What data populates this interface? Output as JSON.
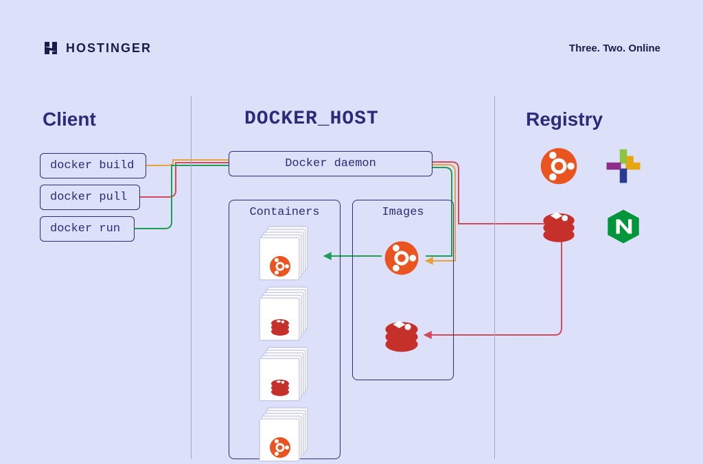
{
  "brand": {
    "name": "HOSTINGER",
    "tagline": "Three. Two. Online"
  },
  "columns": {
    "client": "Client",
    "host": "DOCKER_HOST",
    "registry": "Registry"
  },
  "client": {
    "cmd_build": "docker build",
    "cmd_pull": "docker pull",
    "cmd_run": "docker run"
  },
  "host": {
    "daemon": "Docker daemon",
    "containers_label": "Containers",
    "images_label": "Images"
  },
  "registry_items": [
    "ubuntu",
    "centos",
    "redis",
    "nginx"
  ],
  "containers": [
    "ubuntu",
    "redis",
    "redis",
    "ubuntu"
  ],
  "images": [
    "ubuntu",
    "redis"
  ],
  "colors": {
    "build": "#e9a13b",
    "pull": "#d14a5a",
    "run": "#1f9d55",
    "stroke": "#2a2c7a"
  }
}
